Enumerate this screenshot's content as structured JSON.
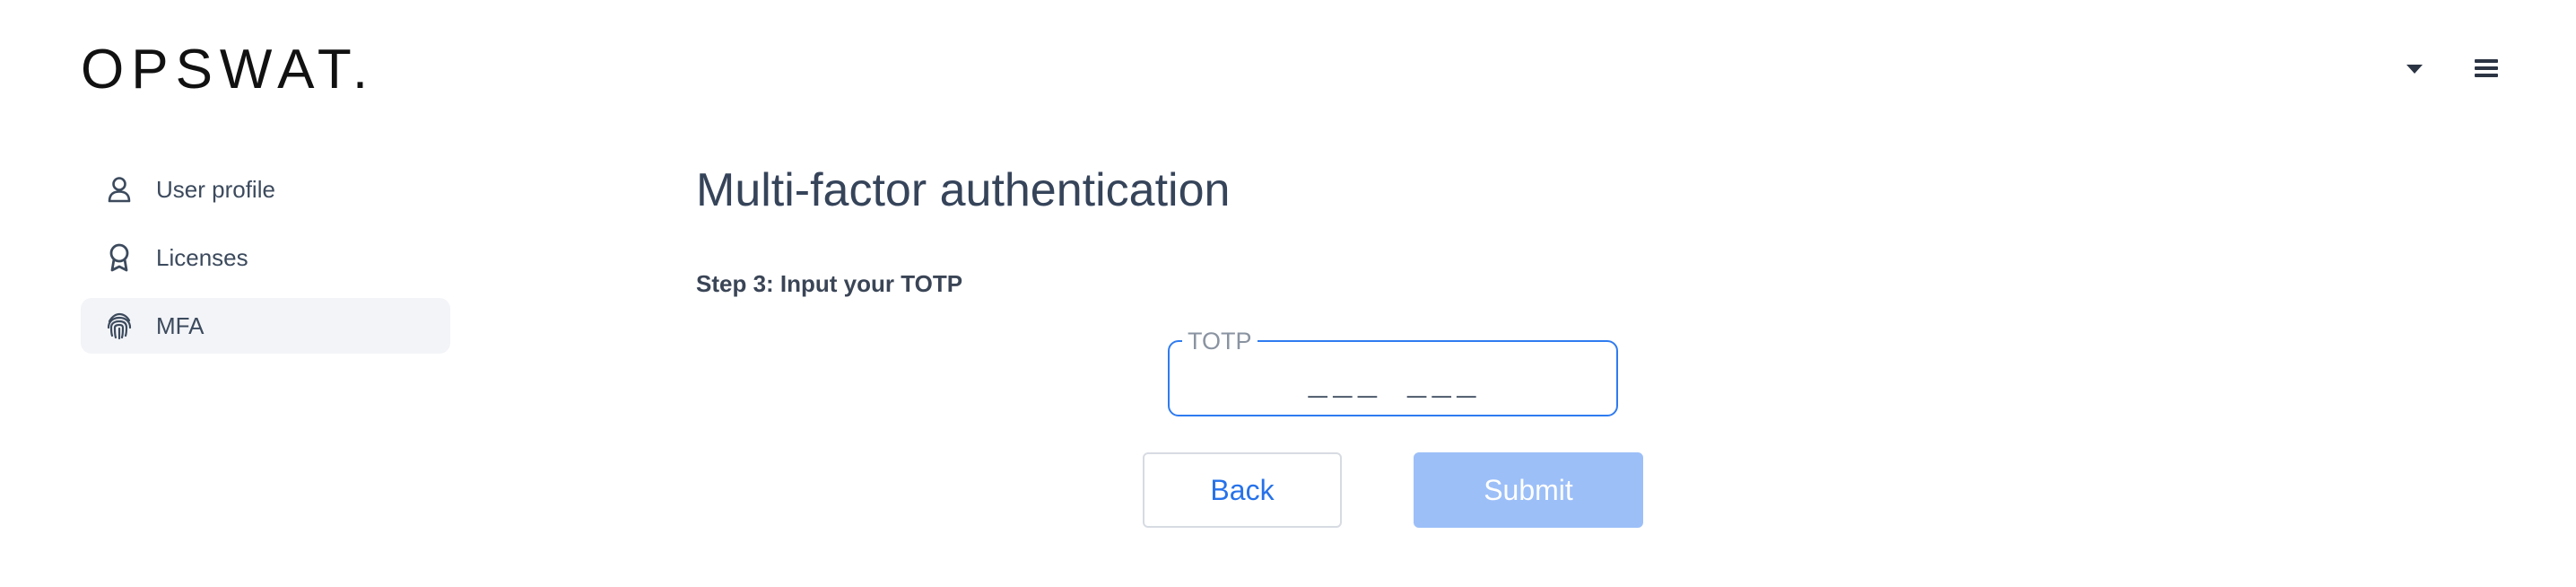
{
  "header": {
    "logo_text": "OPSWAT.",
    "dropdown_icon": "caret-down-icon",
    "menu_icon": "hamburger-menu-icon"
  },
  "sidebar": {
    "items": [
      {
        "label": "User profile",
        "icon": "user-icon",
        "active": false
      },
      {
        "label": "Licenses",
        "icon": "award-ribbon-icon",
        "active": false
      },
      {
        "label": "MFA",
        "icon": "fingerprint-icon",
        "active": true
      }
    ]
  },
  "main": {
    "title": "Multi-factor authentication",
    "step_label": "Step 3: Input your TOTP",
    "totp": {
      "label": "TOTP",
      "placeholder": "___ ___",
      "value": ""
    },
    "back_label": "Back",
    "submit_label": "Submit"
  },
  "colors": {
    "accent": "#2f7bf0",
    "submit_disabled": "#9cbff8",
    "text": "#3a4556",
    "active_bg": "#f3f4f8"
  }
}
